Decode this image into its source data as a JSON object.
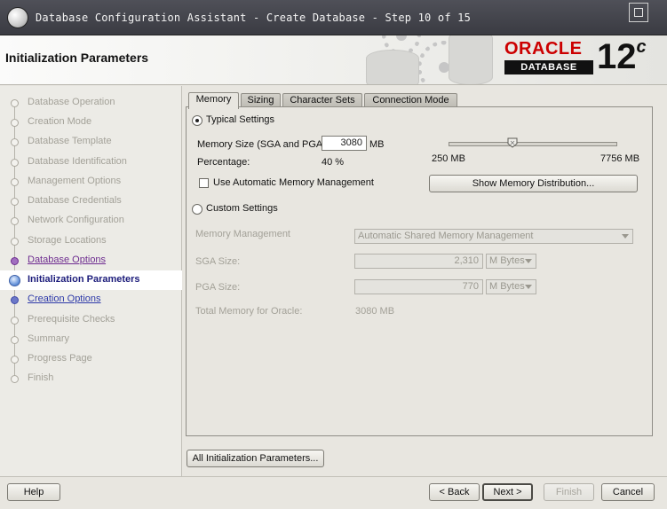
{
  "window": {
    "title": "Database Configuration Assistant - Create Database - Step 10 of 15"
  },
  "header": {
    "page_title": "Initialization Parameters",
    "logo_brand": "ORACLE",
    "logo_product": "DATABASE",
    "version": "12",
    "version_suffix": "c"
  },
  "nav": {
    "items": [
      {
        "label": "Database Operation",
        "state": "done"
      },
      {
        "label": "Creation Mode",
        "state": "done"
      },
      {
        "label": "Database Template",
        "state": "done"
      },
      {
        "label": "Database Identification",
        "state": "done"
      },
      {
        "label": "Management Options",
        "state": "done"
      },
      {
        "label": "Database Credentials",
        "state": "done"
      },
      {
        "label": "Network Configuration",
        "state": "done"
      },
      {
        "label": "Storage Locations",
        "state": "done"
      },
      {
        "label": "Database Options",
        "state": "visited"
      },
      {
        "label": "Initialization Parameters",
        "state": "current"
      },
      {
        "label": "Creation Options",
        "state": "visited"
      },
      {
        "label": "Prerequisite Checks",
        "state": "pending"
      },
      {
        "label": "Summary",
        "state": "pending"
      },
      {
        "label": "Progress Page",
        "state": "pending"
      },
      {
        "label": "Finish",
        "state": "pending"
      }
    ]
  },
  "tabs": [
    {
      "label": "Memory",
      "active": true
    },
    {
      "label": "Sizing",
      "active": false
    },
    {
      "label": "Character Sets",
      "active": false
    },
    {
      "label": "Connection Mode",
      "active": false
    }
  ],
  "memory": {
    "typical_label": "Typical Settings",
    "memory_size_label": "Memory Size (SGA and PGA):",
    "memory_size_value": "3080",
    "memory_size_unit": "MB",
    "percentage_label": "Percentage:",
    "percentage_value": "40 %",
    "slider_min_label": "250 MB",
    "slider_max_label": "7756 MB",
    "slider_min": 250,
    "slider_max": 7756,
    "slider_value": 3080,
    "amm_label": "Use Automatic Memory Management",
    "show_dist_button": "Show Memory Distribution...",
    "custom_label": "Custom Settings",
    "mem_mgmt_label": "Memory Management",
    "mem_mgmt_value": "Automatic Shared Memory Management",
    "sga_label": "SGA Size:",
    "sga_value": "2,310",
    "sga_unit": "M Bytes",
    "pga_label": "PGA Size:",
    "pga_value": "770",
    "pga_unit": "M Bytes",
    "total_label": "Total Memory for Oracle:",
    "total_value": "3080 MB"
  },
  "all_params_button": "All Initialization Parameters...",
  "footer": {
    "help": "Help",
    "back": "< Back",
    "next": "Next >",
    "finish": "Finish",
    "cancel": "Cancel"
  }
}
